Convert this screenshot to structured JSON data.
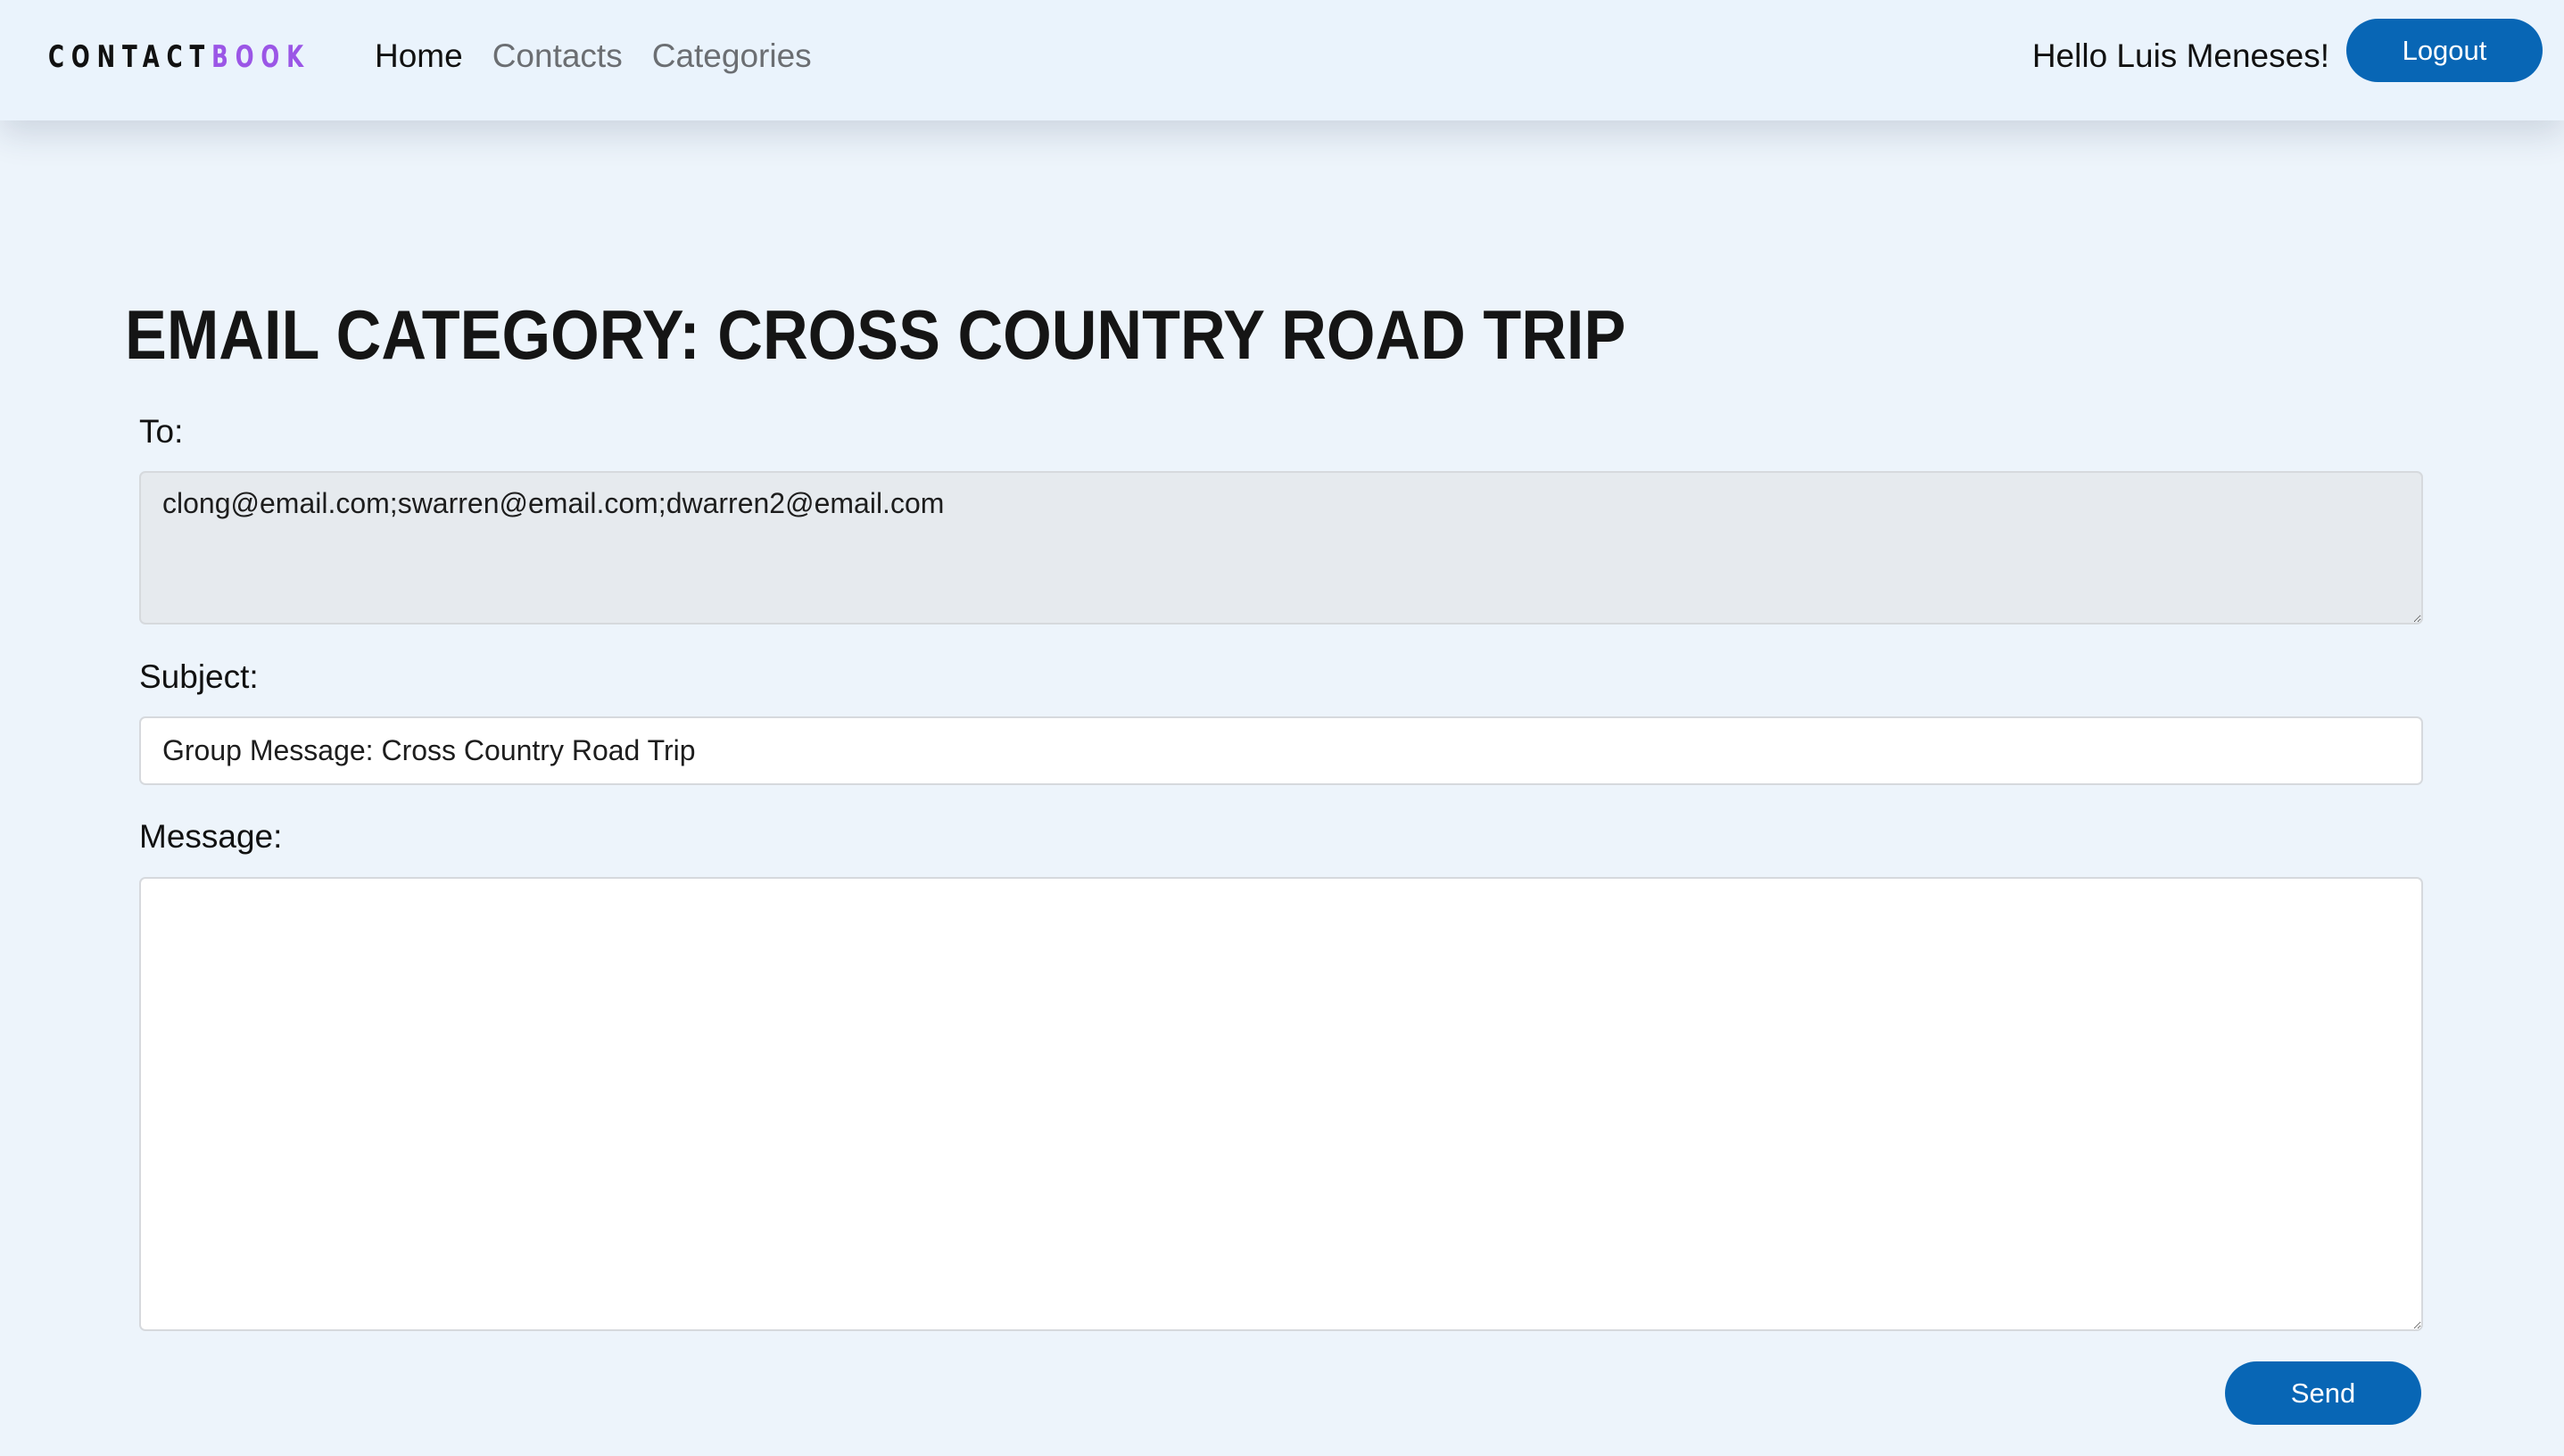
{
  "brand": {
    "part1": "CONTACT",
    "part2": "BOOK",
    "accent_color": "#9b56e6"
  },
  "nav": {
    "items": [
      {
        "label": "Home",
        "active": true
      },
      {
        "label": "Contacts",
        "active": false
      },
      {
        "label": "Categories",
        "active": false
      }
    ],
    "greeting": "Hello Luis Meneses!",
    "logout_label": "Logout"
  },
  "page": {
    "title": "EMAIL CATEGORY: CROSS COUNTRY ROAD TRIP"
  },
  "form": {
    "to_label": "To:",
    "to_value": "clong@email.com;swarren@email.com;dwarren2@email.com",
    "subject_label": "Subject:",
    "subject_value": "Group Message: Cross Country Road Trip",
    "message_label": "Message:",
    "message_value": "",
    "send_label": "Send"
  },
  "colors": {
    "primary_button": "#0866b5",
    "background": "#edf4fb",
    "readonly_field": "#e6eaee"
  }
}
